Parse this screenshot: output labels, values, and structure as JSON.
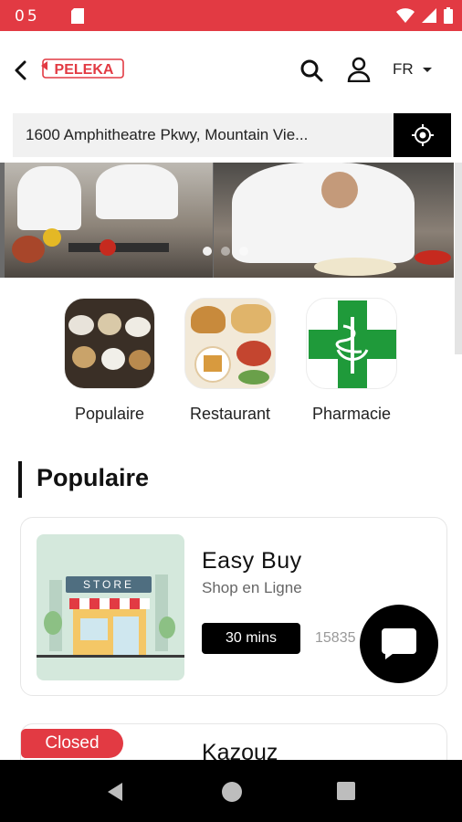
{
  "status_bar": {
    "time": "05",
    "icons": [
      "sd-card-icon",
      "wifi-icon",
      "signal-icon",
      "battery-icon"
    ]
  },
  "header": {
    "logo_text": "PELEKA",
    "language": "FR"
  },
  "address": {
    "value": "1600 Amphitheatre Pkwy, Mountain Vie..."
  },
  "banner": {
    "slides": 3,
    "active_slide": 1
  },
  "categories": [
    {
      "label": "Populaire"
    },
    {
      "label": "Restaurant"
    },
    {
      "label": "Pharmacie"
    }
  ],
  "section": {
    "title": "Populaire"
  },
  "stores": [
    {
      "name": "Easy Buy",
      "type": "Shop en Ligne",
      "time": "30 mins",
      "number": "15835",
      "store_sign": "STORE"
    },
    {
      "name": "Kazouz",
      "status": "Closed"
    }
  ],
  "colors": {
    "brand": "#e23a43",
    "black": "#000000",
    "pharmacy_green": "#1f9a3a"
  }
}
